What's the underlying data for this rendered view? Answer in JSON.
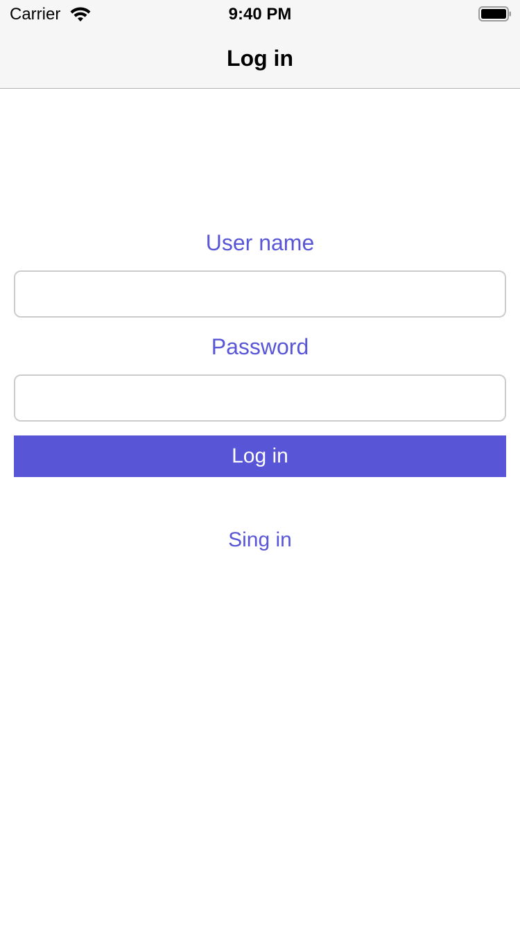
{
  "status_bar": {
    "carrier": "Carrier",
    "time": "9:40 PM",
    "wifi_icon": "wifi-icon",
    "battery_icon": "battery-icon"
  },
  "nav": {
    "title": "Log in"
  },
  "form": {
    "username_label": "User name",
    "username_value": "",
    "password_label": "Password",
    "password_value": "",
    "login_button": "Log in",
    "signin_link": "Sing in"
  },
  "colors": {
    "accent": "#5856d6",
    "nav_background": "#f6f6f6",
    "field_border": "#cccccc"
  }
}
